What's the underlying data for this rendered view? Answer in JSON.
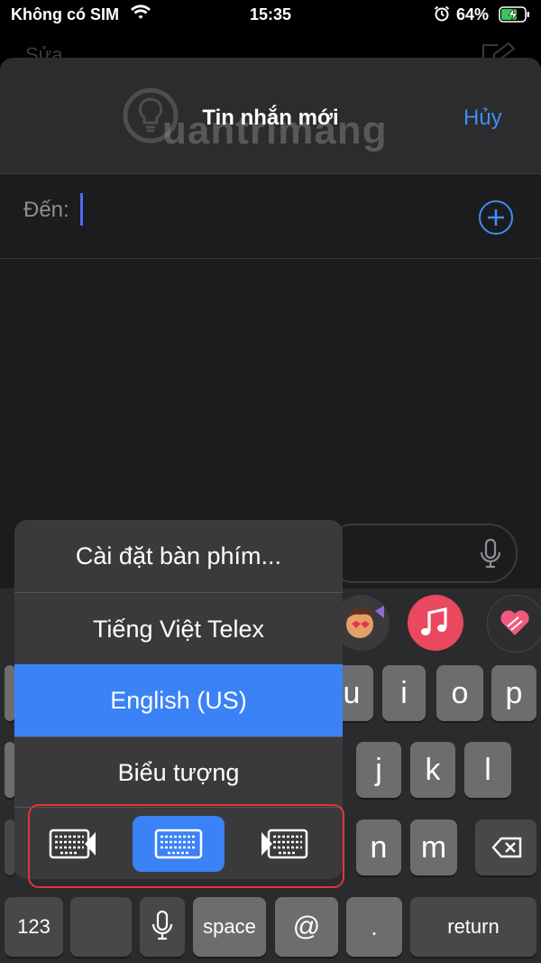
{
  "status": {
    "carrier": "Không có SIM",
    "time": "15:35",
    "battery": "64%"
  },
  "background": {
    "edit_label": "Sửa"
  },
  "sheet": {
    "title": "Tin nhắn mới",
    "cancel": "Hủy",
    "to_label": "Đến:"
  },
  "watermark": "uantrimang",
  "keyboard": {
    "row1": [
      "u",
      "i",
      "o",
      "p"
    ],
    "row2": [
      "j",
      "k",
      "l"
    ],
    "row3": [
      "n",
      "m"
    ],
    "numbers": "123",
    "space": "space",
    "at": "@",
    "period": ".",
    "return": "return"
  },
  "popup": {
    "items": [
      "Cài đặt bàn phím...",
      "Tiếng Việt Telex",
      "English (US)",
      "Biểu tượng"
    ],
    "selected_index": 2,
    "modes": [
      "keyboard-left-icon",
      "keyboard-center-icon",
      "keyboard-right-icon"
    ],
    "selected_mode": 1
  },
  "colors": {
    "accent": "#3d8ef7",
    "selection": "#3b82f6",
    "highlight_box": "#e0353b"
  }
}
